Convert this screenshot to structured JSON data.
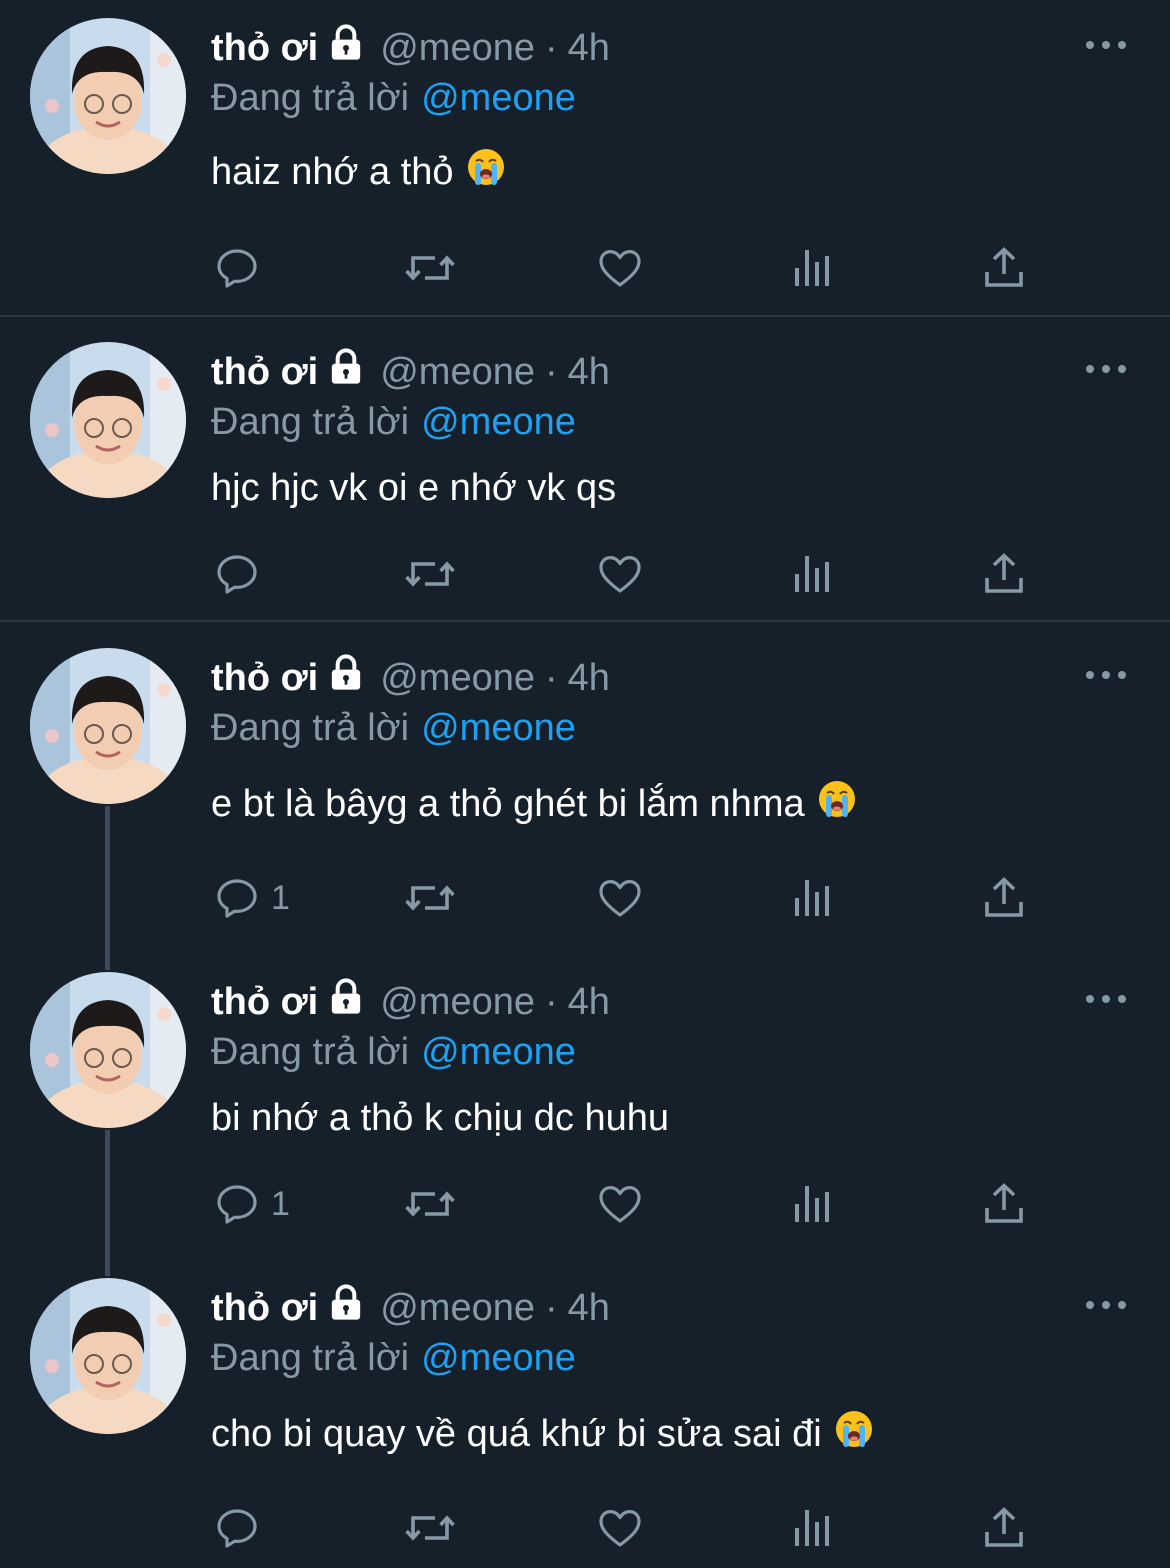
{
  "colors": {
    "background": "#15202b",
    "divider": "#2a3745",
    "text": "#ffffff",
    "muted": "#8899a6",
    "mention": "#1da1f2"
  },
  "tweets": [
    {
      "name": "thỏ ơi",
      "handle": "@meone",
      "separator": "·",
      "time": "4h",
      "reply_prefix": "Đang trả lời",
      "reply_mention": "@meone",
      "text": "haiz nhớ a thỏ",
      "emoji": "loudly-crying-face",
      "reply_count": ""
    },
    {
      "name": "thỏ ơi",
      "handle": "@meone",
      "separator": "·",
      "time": "4h",
      "reply_prefix": "Đang trả lời",
      "reply_mention": "@meone",
      "text": "hjc hjc vk oi e nhớ vk qs",
      "emoji": "",
      "reply_count": ""
    },
    {
      "name": "thỏ ơi",
      "handle": "@meone",
      "separator": "·",
      "time": "4h",
      "reply_prefix": "Đang trả lời",
      "reply_mention": "@meone",
      "text": "e bt là bâyg a thỏ ghét bi lắm nhma",
      "emoji": "loudly-crying-face",
      "reply_count": "1"
    },
    {
      "name": "thỏ ơi",
      "handle": "@meone",
      "separator": "·",
      "time": "4h",
      "reply_prefix": "Đang trả lời",
      "reply_mention": "@meone",
      "text": "bi nhớ a thỏ k chịu dc huhu",
      "emoji": "",
      "reply_count": "1"
    },
    {
      "name": "thỏ ơi",
      "handle": "@meone",
      "separator": "·",
      "time": "4h",
      "reply_prefix": "Đang trả lời",
      "reply_mention": "@meone",
      "text": "cho bi quay về quá khứ bi sửa sai đi",
      "emoji": "loudly-crying-face",
      "reply_count": ""
    }
  ],
  "icons": {
    "lock": "lock-icon",
    "more": "more-icon",
    "reply": "reply-icon",
    "retweet": "retweet-icon",
    "like": "like-icon",
    "analytics": "analytics-icon",
    "share": "share-icon"
  }
}
